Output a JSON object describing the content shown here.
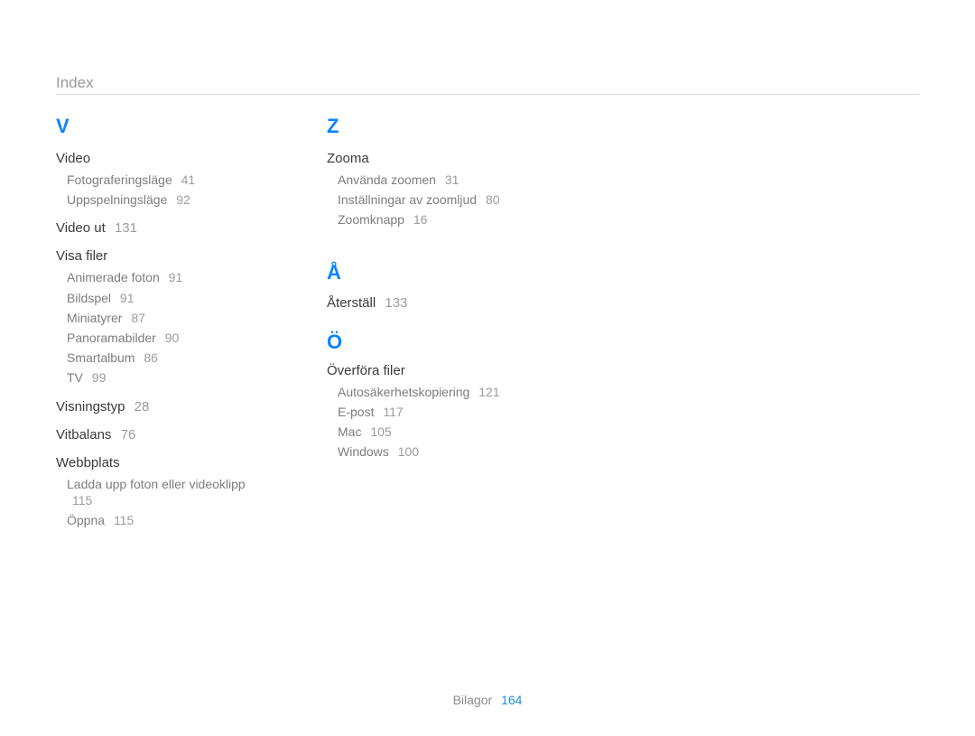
{
  "header": {
    "title": "Index"
  },
  "footer": {
    "label": "Bilagor",
    "page": "164"
  },
  "col1": {
    "letter": "V",
    "video": {
      "label": "Video",
      "items": [
        {
          "label": "Fotograferingsläge",
          "page": "41"
        },
        {
          "label": "Uppspelningsläge",
          "page": "92"
        }
      ]
    },
    "video_ut": {
      "label": "Video ut",
      "page": "131"
    },
    "visa_filer": {
      "label": "Visa filer",
      "items": [
        {
          "label": "Animerade foton",
          "page": "91"
        },
        {
          "label": "Bildspel",
          "page": "91"
        },
        {
          "label": "Miniatyrer",
          "page": "87"
        },
        {
          "label": "Panoramabilder",
          "page": "90"
        },
        {
          "label": "Smartalbum",
          "page": "86"
        },
        {
          "label": "TV",
          "page": "99"
        }
      ]
    },
    "visningstyp": {
      "label": "Visningstyp",
      "page": "28"
    },
    "vitbalans": {
      "label": "Vitbalans",
      "page": "76"
    },
    "webbplats": {
      "label": "Webbplats",
      "items": [
        {
          "label": "Ladda upp foton eller videoklipp",
          "page": "115"
        },
        {
          "label": "Öppna",
          "page": "115"
        }
      ]
    }
  },
  "col2": {
    "letter_z": "Z",
    "zooma": {
      "label": "Zooma",
      "items": [
        {
          "label": "Använda zoomen",
          "page": "31"
        },
        {
          "label": "Inställningar av zoomljud",
          "page": "80"
        },
        {
          "label": "Zoomknapp",
          "page": "16"
        }
      ]
    },
    "letter_ring": "Å",
    "aterstall": {
      "label": "Återställ",
      "page": "133"
    },
    "letter_dia": "Ö",
    "overfora": {
      "label": "Överföra filer",
      "items": [
        {
          "label": "Autosäkerhetskopiering",
          "page": "121"
        },
        {
          "label": "E-post",
          "page": "117"
        },
        {
          "label": "Mac",
          "page": "105"
        },
        {
          "label": "Windows",
          "page": "100"
        }
      ]
    }
  }
}
